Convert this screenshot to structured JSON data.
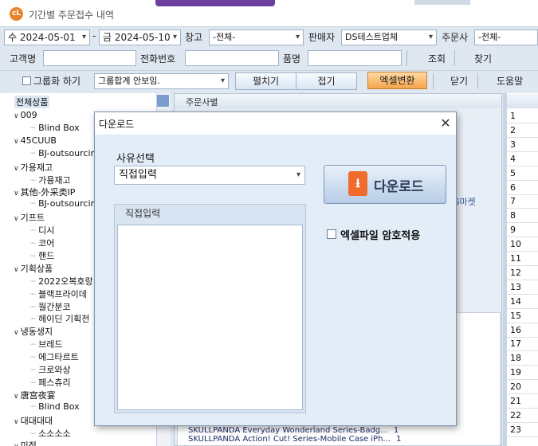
{
  "window": {
    "title": "기간별 주문접수 내역",
    "logo_text": "cL"
  },
  "filters": {
    "start_weekday": "수",
    "start_date": "2024-05-01",
    "dash": "-",
    "end_weekday": "금",
    "end_date": "2024-05-10",
    "warehouse_label": "창고",
    "warehouse_value": "-전체-",
    "seller_label": "판매자",
    "seller_value": "DS테스트업체",
    "orderer_label": "주문사",
    "orderer_value": "-전체-",
    "customer_label": "고객명",
    "customer_value": "",
    "phone_label": "전화번호",
    "phone_value": "",
    "product_label": "품명",
    "product_value": "",
    "search_button": "조회",
    "find_button": "찾기"
  },
  "toolbar": {
    "group_checkbox_label": "그룹화 하기",
    "group_select": "그룹합계 안보임.",
    "expand_button": "펼치기",
    "collapse_button": "접기",
    "excel_button": "엑셀변환",
    "close_button": "닫기",
    "help_button": "도움말"
  },
  "tree": {
    "root": "전체상품",
    "items": [
      {
        "label": "009",
        "level": 1
      },
      {
        "label": "Blind Box",
        "level": 2
      },
      {
        "label": "45CUUB",
        "level": 1
      },
      {
        "label": "BJ-outsourcing",
        "level": 2
      },
      {
        "label": "가용재고",
        "level": 1
      },
      {
        "label": "가용재고",
        "level": 2
      },
      {
        "label": "其他-外采类IP",
        "level": 1
      },
      {
        "label": "BJ-outsourcing",
        "level": 2
      },
      {
        "label": "기프트",
        "level": 1
      },
      {
        "label": "디시",
        "level": 2
      },
      {
        "label": "코어",
        "level": 2
      },
      {
        "label": "핸드",
        "level": 2
      },
      {
        "label": "기획상품",
        "level": 1
      },
      {
        "label": "2022오복호랑",
        "level": 2
      },
      {
        "label": "블랙프라이데",
        "level": 2
      },
      {
        "label": "월간분코",
        "level": 2
      },
      {
        "label": "헤이딘 기획전",
        "level": 2
      },
      {
        "label": "냉동생지",
        "level": 1
      },
      {
        "label": "브레드",
        "level": 2
      },
      {
        "label": "에그타르트",
        "level": 2
      },
      {
        "label": "크로와상",
        "level": 2
      },
      {
        "label": "페스츄리",
        "level": 2
      },
      {
        "label": "唐宫夜宴",
        "level": 1
      },
      {
        "label": "Blind Box",
        "level": 2
      },
      {
        "label": "대대대대",
        "level": 1
      },
      {
        "label": "소소소소",
        "level": 2
      },
      {
        "label": "미정",
        "level": 1
      }
    ]
  },
  "middle": {
    "header": "주문사별",
    "gmarket_label": "G마켓",
    "bottom_rows": [
      {
        "text": "SKULLPANDA Everyday Wonderland Series-Badg...",
        "qty": "1"
      },
      {
        "text": "SKULLPANDA Action! Cut! Series-Mobile Case iPh...",
        "qty": "1"
      }
    ]
  },
  "grid": {
    "rows": [
      "1",
      "2",
      "3",
      "4",
      "5",
      "6",
      "7",
      "8",
      "9",
      "10",
      "11",
      "12",
      "13",
      "14",
      "15",
      "16",
      "17",
      "18",
      "19",
      "20",
      "21",
      "22",
      "23"
    ]
  },
  "dialog": {
    "title": "다운로드",
    "close": "✕",
    "reason_label": "사유선택",
    "reason_value": "직접입력",
    "direct_input_group": "직접입력",
    "direct_input_value": "",
    "download_button": "다운로드",
    "encrypt_label": "엑셀파일 암호적용",
    "encrypt_checked": false
  }
}
